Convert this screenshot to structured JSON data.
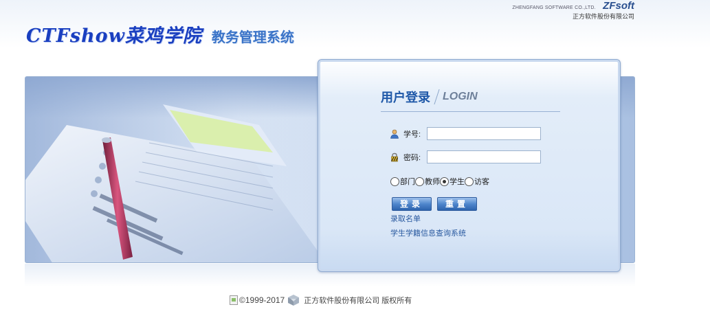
{
  "header": {
    "corp_en": "ZHENGFANG SOFTWARE CO.,LTD.",
    "corp_logo": "ZFsoft",
    "corp_cn": "正方软件股份有限公司",
    "school_name": "CTFshow菜鸡学院",
    "system_name": "教务管理系统"
  },
  "login": {
    "title": "用户登录",
    "subtitle": "LOGIN",
    "username_label": "学号:",
    "username_value": "",
    "password_label": "密码:",
    "password_value": "",
    "roles": [
      {
        "label": "部门",
        "checked": false
      },
      {
        "label": "教师",
        "checked": false
      },
      {
        "label": "学生",
        "checked": true
      },
      {
        "label": "访客",
        "checked": false
      }
    ],
    "login_button": "登录",
    "reset_button": "重置",
    "link_admission": "录取名单",
    "link_status": "学生学籍信息查询系统"
  },
  "footer": {
    "copyright": "©1999-2017",
    "company": "正方软件股份有限公司  版权所有"
  },
  "icons": {
    "user": "user-icon",
    "lock": "lock-icon",
    "footer_logo": "zfsoft-logo-icon"
  },
  "colors": {
    "title_blue": "#1a3fc0",
    "system_blue": "#3b74c8",
    "button_blue": "#2c63ad",
    "link_blue": "#2a5aa0"
  }
}
